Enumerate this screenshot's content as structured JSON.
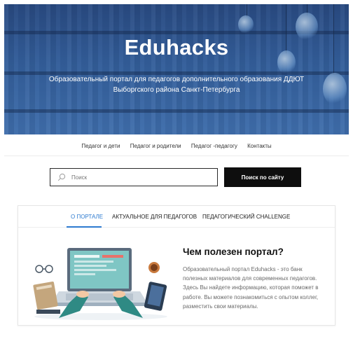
{
  "hero": {
    "title": "Eduhacks",
    "subtitle": "Образовательный портал для педагогов дополнительного образования ДДЮТ Выборгского района Санкт-Петербурга"
  },
  "nav": {
    "items": [
      "Педагог и дети",
      "Педагог и родители",
      "Педагог -педагогу",
      "Контакты"
    ]
  },
  "search": {
    "placeholder": "Поиск",
    "button_label": "Поиск по сайту"
  },
  "tabs": {
    "items": [
      "О ПОРТАЛЕ",
      "АКТУАЛЬНОЕ ДЛЯ ПЕДАГОГОВ",
      "ПЕДАГОГИЧЕСКИЙ CHALLENGE"
    ],
    "active_index": 0
  },
  "feature": {
    "title": "Чем полезен портал?",
    "text": "Образовательный портал Eduhacks - это банк полезных материалов для современных педагогов. Здесь Вы найдете информацию, которая поможет в работе. Вы можете познакомиться с опытом коллег, разместить свои материалы."
  },
  "colors": {
    "accent": "#2e7bd0",
    "hero": "#3a6aa9",
    "button": "#0e0e0e"
  }
}
